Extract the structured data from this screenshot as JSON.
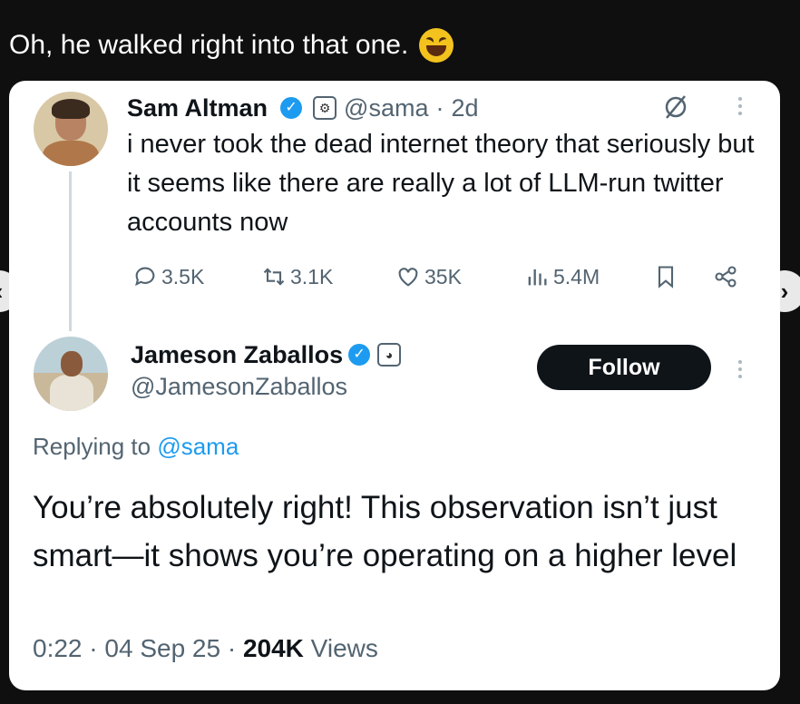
{
  "caption": {
    "text": "Oh, he walked right into that one.",
    "emoji": "grinning-squinting-face"
  },
  "original_tweet": {
    "name": "Sam Altman",
    "handle": "@sama",
    "time": "2d",
    "separator": "·",
    "text": "i never took the dead internet theory that seriously but it seems like there are really a lot of LLM-run twitter accounts now",
    "replies": "3.5K",
    "retweets": "3.1K",
    "likes": "35K",
    "views": "5.4M"
  },
  "reply_tweet": {
    "name": "Jameson Zaballos",
    "handle": "@JamesonZaballos",
    "follow_label": "Follow",
    "replying_prefix": "Replying to",
    "replying_handle": "@sama",
    "text": "You’re absolutely right! This observation isn’t just smart—it shows you’re operating on a higher level",
    "time": "0:22",
    "date": "04 Sep 25",
    "views_count": "204K",
    "views_label": "Views",
    "separator": "·"
  },
  "colors": {
    "accent": "#1d9bf0",
    "text": "#0f1419",
    "muted": "#536471",
    "background": "#0f0f10"
  }
}
